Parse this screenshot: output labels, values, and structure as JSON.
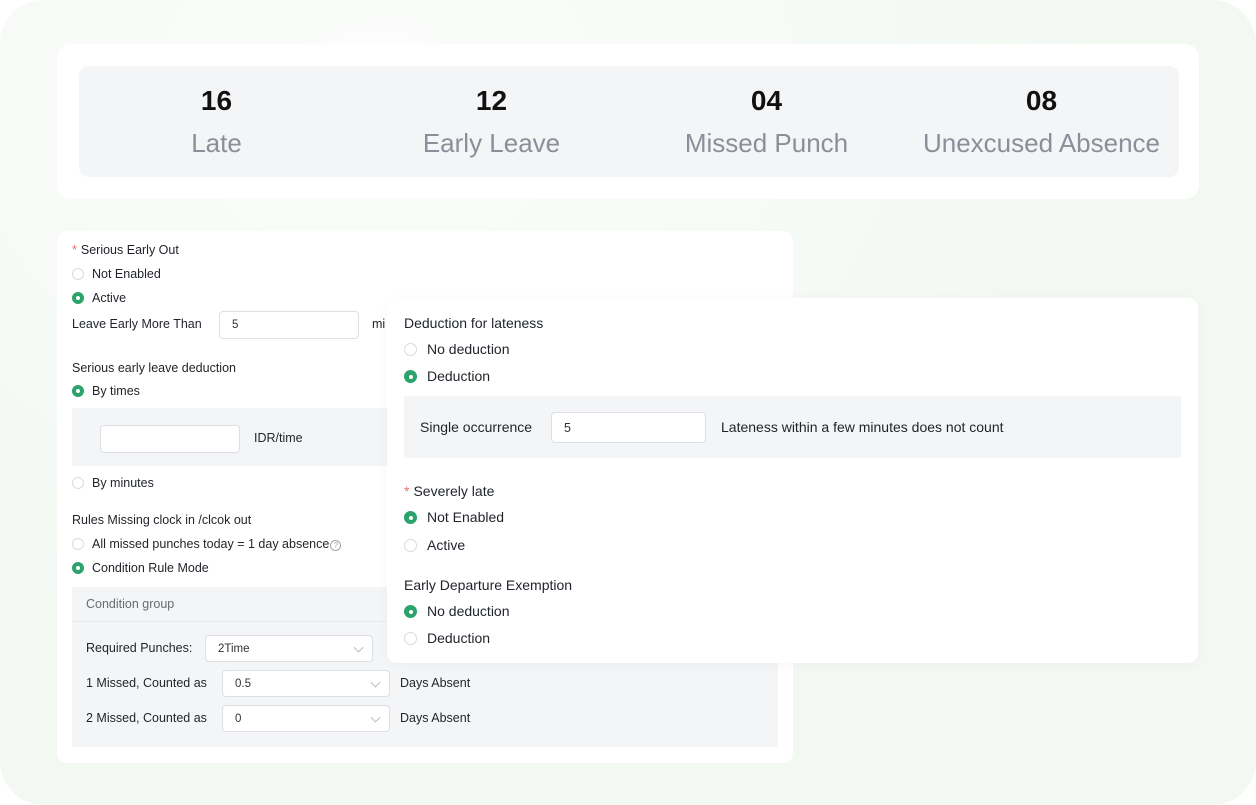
{
  "stats": [
    {
      "value": "16",
      "label": "Late"
    },
    {
      "value": "12",
      "label": "Early Leave"
    },
    {
      "value": "04",
      "label": "Missed Punch"
    },
    {
      "value": "08",
      "label": "Unexcused Absence"
    }
  ],
  "rules": {
    "required_mark": "*",
    "serious_early_out_title": "Serious Early Out",
    "opt_not_enabled": "Not Enabled",
    "opt_active": "Active",
    "leave_early_label": "Leave Early More Than",
    "leave_early_value": "5",
    "leave_early_unit": "mi",
    "deduction_title": "Serious early leave deduction",
    "opt_by_times": "By times",
    "idr_value": "",
    "idr_unit": "IDR/time",
    "opt_by_minutes": "By minutes",
    "missing_title": "Rules Missing clock in /clcok out",
    "opt_all_missed": "All missed punches today = 1 day absence",
    "opt_condition_mode": "Condition Rule Mode",
    "condition_group": "Condition group",
    "required_punches_label": "Required Punches:",
    "required_punches_value": "2Time",
    "missed1_label": "1 Missed, Counted as",
    "missed1_value": "0.5",
    "missed2_label": "2 Missed, Counted as",
    "missed2_value": "0",
    "days_absent": "Days Absent"
  },
  "overlay": {
    "lateness_title": "Deduction for lateness",
    "opt_no_deduction": "No deduction",
    "opt_deduction": "Deduction",
    "single_occurrence_label": "Single occurrence",
    "single_occurrence_value": "5",
    "lateness_note": "Lateness within a few minutes does not count",
    "required_mark": "*",
    "severely_late_title": "Severely late",
    "opt_not_enabled": "Not Enabled",
    "opt_active": "Active",
    "early_departure_title": "Early Departure Exemption",
    "opt_no_deduction_2": "No deduction",
    "opt_deduction_2": "Deduction"
  },
  "colors": {
    "accent": "#2ba36a",
    "required": "#f56c6c",
    "background": "#f3f8f3"
  }
}
